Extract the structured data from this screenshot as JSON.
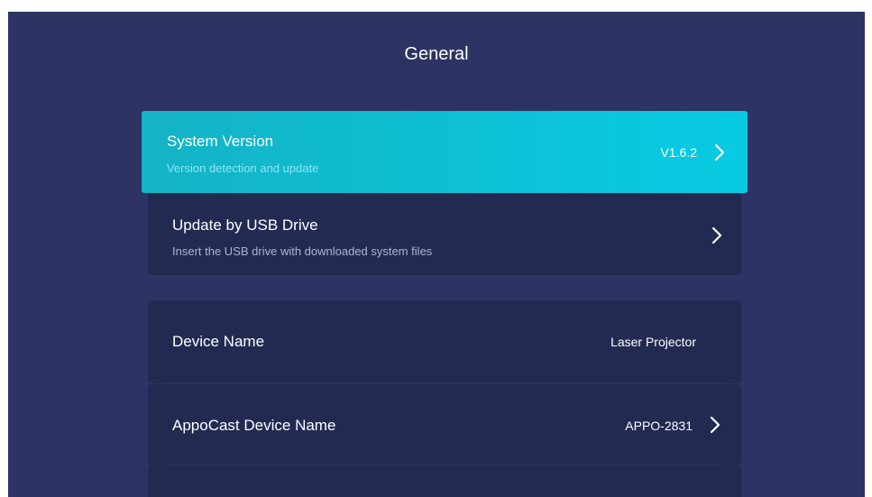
{
  "page": {
    "title": "General"
  },
  "items": [
    {
      "title": "System Version",
      "subtitle": "Version detection and update",
      "value": "V1.6.2",
      "focused": true
    },
    {
      "title": "Update by USB Drive",
      "subtitle": "Insert the USB drive with downloaded system files"
    },
    {
      "title": "Device Name",
      "value": "Laser Projector"
    },
    {
      "title": "AppoCast Device Name",
      "value": "APPO-2831"
    }
  ],
  "icons": {
    "chevron": "chevron-right-icon"
  },
  "colors": {
    "background": "#2d3363",
    "card": "#232a52",
    "focus_start": "#14b3c5",
    "focus_end": "#08cbe3",
    "text": "#ffffff"
  }
}
